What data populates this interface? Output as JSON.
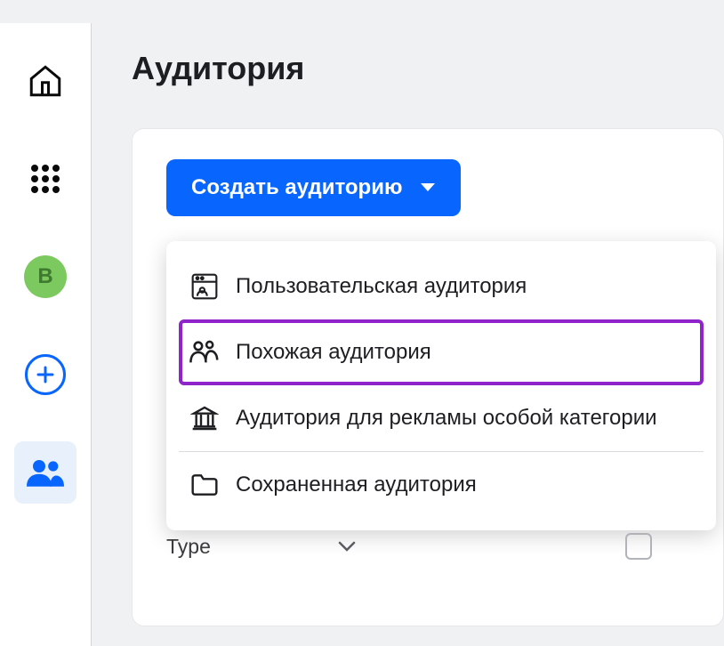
{
  "sidebar": {
    "avatar_letter": "В"
  },
  "page": {
    "title": "Аудитория"
  },
  "create_button": {
    "label": "Создать аудиторию"
  },
  "dropdown": {
    "items": [
      {
        "label": "Пользовательская аудитория",
        "icon": "custom-audience"
      },
      {
        "label": "Похожая аудитория",
        "icon": "lookalike",
        "highlighted": true
      },
      {
        "label": "Аудитория для рекламы особой категории",
        "icon": "special-category"
      },
      {
        "label": "Сохраненная аудитория",
        "icon": "saved"
      }
    ]
  },
  "filters": {
    "type_label": "Type"
  }
}
